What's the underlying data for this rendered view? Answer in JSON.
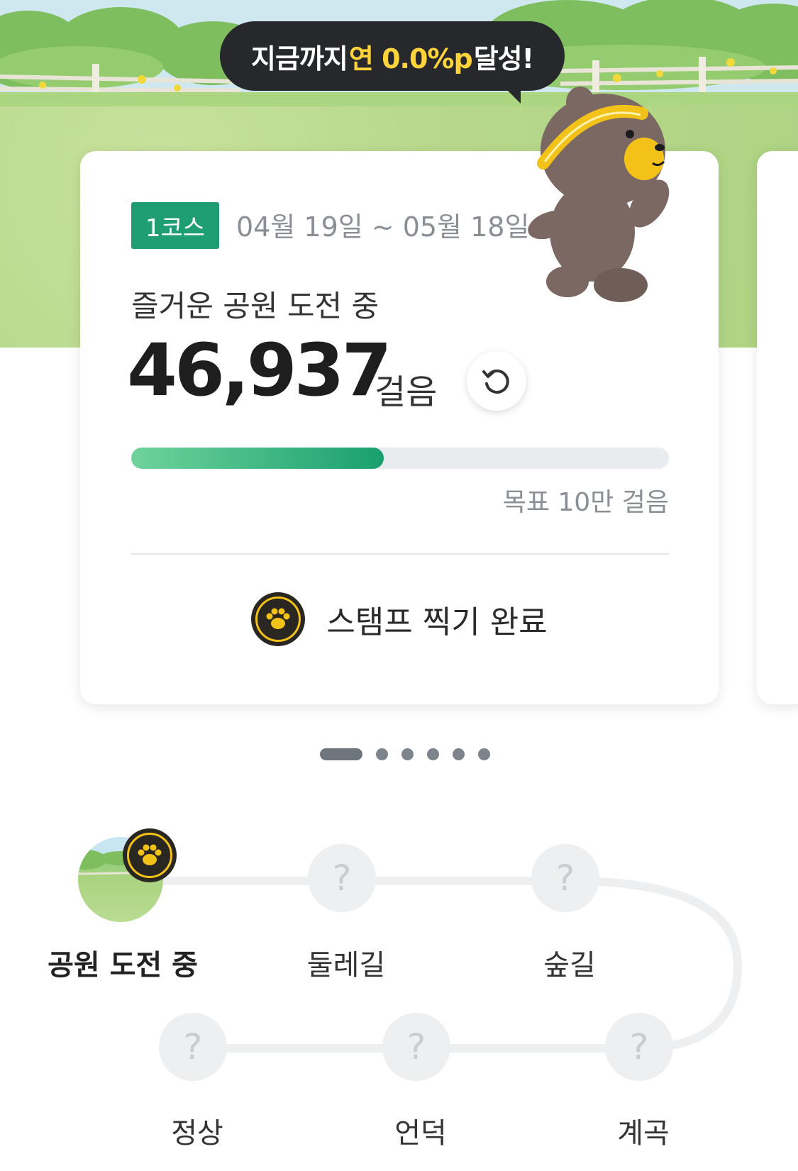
{
  "banner": {
    "prefix": "지금까지",
    "highlight": "연 0.0%p",
    "suffix": "달성!"
  },
  "card": {
    "course_badge": "1코스",
    "date_range": "04월 19일 ~ 05월 18일",
    "status": "즐거운 공원 도전 중",
    "steps": "46,937",
    "steps_unit": "걸음",
    "progress_fraction": 0.469,
    "goal": "목표 10만 걸음",
    "stamp_label": "스탬프 찍기 완료"
  },
  "pager": {
    "count": 6,
    "active": 0
  },
  "course_map": {
    "nodes": [
      {
        "label": "공원 도전 중",
        "state": "current"
      },
      {
        "label": "둘레길",
        "state": "locked",
        "glyph": "?"
      },
      {
        "label": "숲길",
        "state": "locked",
        "glyph": "?"
      },
      {
        "label": "계곡",
        "state": "locked",
        "glyph": "?"
      },
      {
        "label": "언덕",
        "state": "locked",
        "glyph": "?"
      },
      {
        "label": "정상",
        "state": "locked",
        "glyph": "?"
      }
    ]
  },
  "colors": {
    "accent": "#1f9e73",
    "bubble": "#26282c",
    "highlight": "#ffd43b",
    "progress_start": "#6fd39c",
    "progress_end": "#19a06f",
    "paw": "#f3c218"
  },
  "icons": {
    "refresh": "refresh-icon",
    "stamp": "paw-stamp-icon",
    "mascot": "bear-mascot"
  }
}
